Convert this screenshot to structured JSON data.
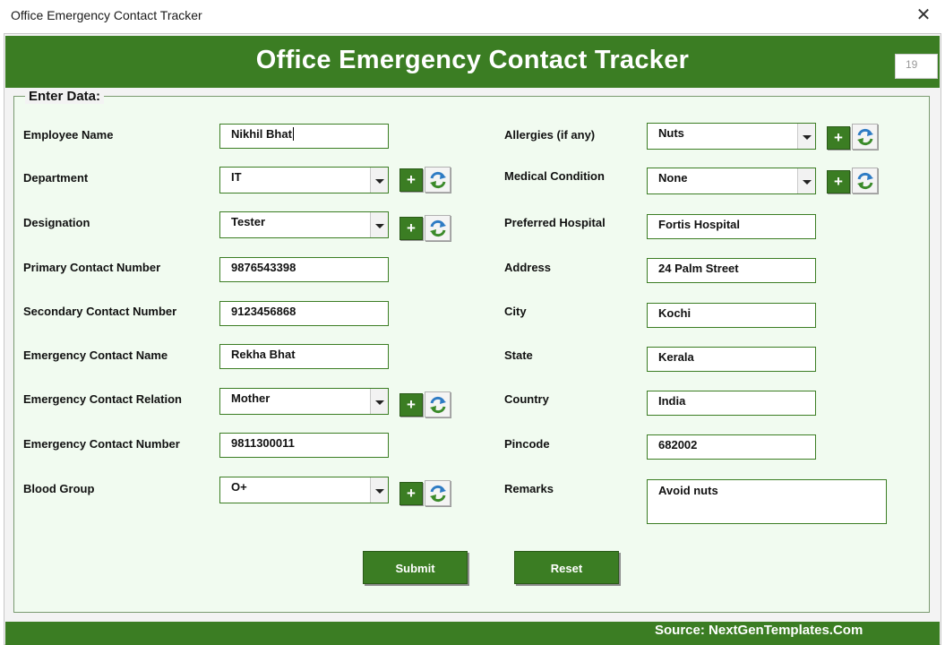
{
  "window": {
    "title": "Office Emergency Contact Tracker",
    "close_glyph": "✕"
  },
  "header": {
    "title": "Office Emergency Contact Tracker",
    "record_id": "19"
  },
  "section_label": "Enter Data:",
  "left": [
    {
      "label": "Employee Name",
      "value": "Nikhil Bhat"
    },
    {
      "label": "Department",
      "value": "IT"
    },
    {
      "label": "Designation",
      "value": "Tester"
    },
    {
      "label": "Primary Contact Number",
      "value": "9876543398"
    },
    {
      "label": "Secondary Contact Number",
      "value": "9123456868"
    },
    {
      "label": "Emergency Contact Name",
      "value": "Rekha Bhat"
    },
    {
      "label": "Emergency Contact Relation",
      "value": "Mother"
    },
    {
      "label": "Emergency Contact Number",
      "value": "9811300011"
    },
    {
      "label": "Blood Group",
      "value": "O+"
    }
  ],
  "right": [
    {
      "label": "Allergies (if any)",
      "value": "Nuts"
    },
    {
      "label": "Medical Condition",
      "value": "None"
    },
    {
      "label": "Preferred Hospital",
      "value": "Fortis Hospital"
    },
    {
      "label": "Address",
      "value": "24 Palm Street"
    },
    {
      "label": "City",
      "value": "Kochi"
    },
    {
      "label": "State",
      "value": "Kerala"
    },
    {
      "label": "Country",
      "value": "India"
    },
    {
      "label": "Pincode",
      "value": "682002"
    },
    {
      "label": "Remarks",
      "value": "Avoid nuts"
    }
  ],
  "buttons": {
    "add_glyph": "+",
    "submit": "Submit",
    "reset": "Reset"
  },
  "footer": {
    "source": "Source: NextGenTemplates.Com"
  },
  "colors": {
    "brand_green": "#3b7d23",
    "panel_bg": "#f1fbf0"
  },
  "icons": {
    "add": "plus-icon",
    "refresh": "refresh-icon",
    "dropdown": "chevron-down-icon",
    "close": "close-icon"
  }
}
